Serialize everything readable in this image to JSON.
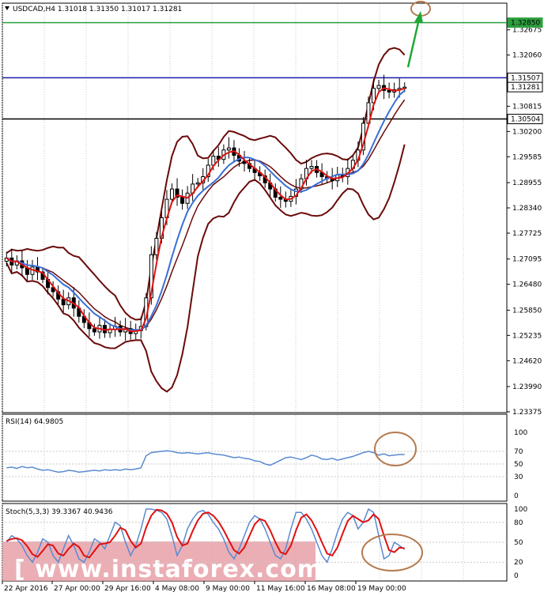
{
  "chart_data": [
    {
      "type": "candlestick",
      "title": "USDCAD,H4  1.31018 1.31350 1.31017 1.31281",
      "x_tick_labels": [
        "22 Apr 2016",
        "27 Apr 00:00",
        "29 Apr 16:00",
        "4 May 08:00",
        "9 May 00:00",
        "11 May 16:00",
        "16 May 08:00",
        "19 May 00:00"
      ],
      "y_tick_labels": [
        "1.32675",
        "1.32060",
        "1.30815",
        "1.30200",
        "1.29585",
        "1.28955",
        "1.28340",
        "1.27725",
        "1.27095",
        "1.26480",
        "1.25850",
        "1.25235",
        "1.24620",
        "1.23990",
        "1.23375"
      ],
      "ylim": [
        1.23375,
        1.33305
      ],
      "price_labels": [
        "1.32850",
        "1.31507",
        "1.31281",
        "1.30504"
      ],
      "levels": [
        {
          "value": 1.3285,
          "color": "#2e9e3e"
        },
        {
          "value": 1.31507,
          "color": "#1c1ca8"
        },
        {
          "value": 1.30504,
          "color": "#000000"
        }
      ],
      "indicators": [
        "Bollinger Bands",
        "Moving Average (red)",
        "Moving Average (blue)"
      ],
      "annotations": [
        "green arrow to target circle near 1.3285"
      ],
      "series": [
        {
          "name": "close",
          "values": [
            1.2712,
            1.2695,
            1.2705,
            1.2688,
            1.2672,
            1.269,
            1.2678,
            1.266,
            1.264,
            1.263,
            1.2612,
            1.2598,
            1.2615,
            1.259,
            1.257,
            1.2555,
            1.254,
            1.2532,
            1.2548,
            1.253,
            1.2538,
            1.2546,
            1.2532,
            1.254,
            1.2528,
            1.2535,
            1.2545,
            1.2615,
            1.272,
            1.276,
            1.281,
            1.2855,
            1.288,
            1.286,
            1.2845,
            1.287,
            1.2892,
            1.2895,
            1.291,
            1.2938,
            1.296,
            1.2952,
            1.2975,
            1.298,
            1.2962,
            1.2948,
            1.2942,
            1.293,
            1.292,
            1.2912,
            1.2895,
            1.288,
            1.286,
            1.2855,
            1.285,
            1.2862,
            1.288,
            1.2905,
            1.293,
            1.2935,
            1.292,
            1.291,
            1.2905,
            1.29,
            1.2915,
            1.291,
            1.293,
            1.295,
            1.2975,
            1.304,
            1.309,
            1.3125,
            1.3132,
            1.312,
            1.3116,
            1.3122,
            1.3125,
            1.3128
          ]
        }
      ]
    },
    {
      "type": "line",
      "title": "RSI(14) 64.9805",
      "ylim": [
        0,
        100
      ],
      "y_tick_labels": [
        "100",
        "70",
        "50",
        "30",
        "0"
      ],
      "series": [
        {
          "name": "RSI(14)",
          "values": [
            44,
            45,
            43,
            46,
            44,
            45,
            42,
            40,
            41,
            39,
            37,
            38,
            40,
            39,
            37,
            38,
            39,
            40,
            39,
            41,
            40,
            41,
            40,
            42,
            41,
            42,
            44,
            63,
            68,
            69,
            70,
            71,
            70,
            68,
            67,
            68,
            67,
            66,
            67,
            68,
            66,
            65,
            64,
            62,
            60,
            61,
            59,
            58,
            55,
            54,
            50,
            48,
            52,
            56,
            60,
            61,
            59,
            57,
            60,
            64,
            62,
            58,
            57,
            59,
            56,
            58,
            60,
            62,
            65,
            68,
            70,
            68,
            64,
            66,
            63,
            64,
            65,
            64.9805
          ]
        }
      ]
    },
    {
      "type": "line",
      "title": "Stoch(5,3,3) 39.3367 40.9436",
      "ylim": [
        0,
        100
      ],
      "y_tick_labels": [
        "100",
        "80",
        "50",
        "20",
        "0"
      ],
      "series": [
        {
          "name": "%K",
          "values": [
            50,
            60,
            55,
            45,
            30,
            20,
            35,
            55,
            50,
            30,
            20,
            40,
            60,
            45,
            25,
            20,
            35,
            55,
            50,
            40,
            60,
            80,
            75,
            50,
            30,
            45,
            70,
            100,
            100,
            98,
            95,
            85,
            60,
            30,
            45,
            70,
            85,
            95,
            98,
            92,
            80,
            70,
            55,
            35,
            25,
            40,
            60,
            80,
            90,
            85,
            70,
            50,
            30,
            25,
            40,
            70,
            95,
            95,
            85,
            70,
            50,
            30,
            20,
            40,
            65,
            85,
            95,
            90,
            70,
            80,
            100,
            95,
            60,
            25,
            30,
            50,
            45,
            39.3367
          ]
        },
        {
          "name": "%D",
          "values": [
            52,
            55,
            56,
            53,
            44,
            32,
            28,
            37,
            47,
            45,
            33,
            30,
            40,
            48,
            43,
            30,
            27,
            37,
            47,
            48,
            50,
            60,
            72,
            68,
            52,
            42,
            48,
            72,
            90,
            99,
            98,
            93,
            80,
            58,
            45,
            48,
            67,
            83,
            93,
            95,
            90,
            81,
            68,
            53,
            38,
            33,
            42,
            60,
            77,
            85,
            82,
            68,
            50,
            35,
            32,
            45,
            68,
            87,
            92,
            83,
            68,
            50,
            33,
            30,
            42,
            63,
            82,
            90,
            85,
            80,
            83,
            92,
            85,
            60,
            38,
            35,
            42,
            40.9436
          ]
        }
      ]
    }
  ],
  "watermark": "[ www.instaforex.com ]",
  "colors": {
    "candle": "#000000",
    "band": "#6b0a0a",
    "ma_red": "#e01010",
    "ma_blue": "#3a6fd8",
    "rsi": "#5a8ad0",
    "stoch_k": "#5a8ad0",
    "stoch_d": "#e01010",
    "circle": "#b57a4e",
    "arrow": "#1fa836",
    "watermark_bg": "#e8a0a8"
  }
}
